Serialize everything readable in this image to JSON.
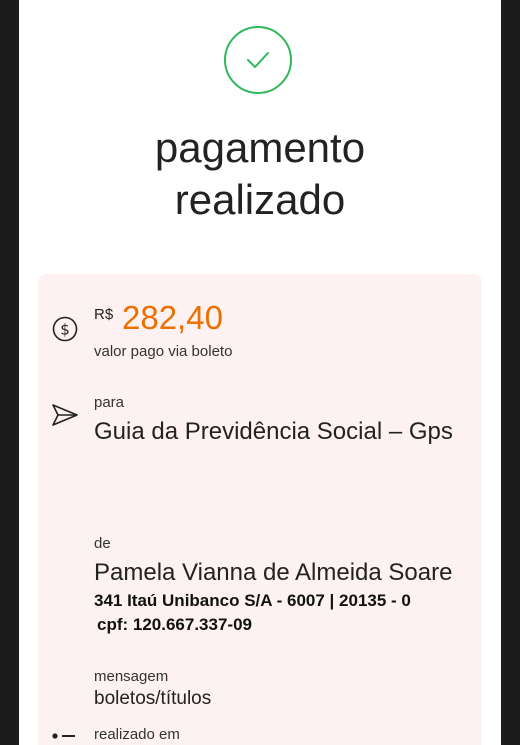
{
  "status": {
    "title_line1": "pagamento",
    "title_line2": "realizado"
  },
  "receipt": {
    "currency": "R$",
    "amount": "282,40",
    "amount_desc": "valor pago via boleto",
    "to_label": "para",
    "to_value": "Guia da Previdência Social – Gps",
    "from_label": "de",
    "from_name": "Pamela Vianna de Almeida Soare",
    "from_bank": "341 Itaú Unibanco S/A - 6007 | 20135 - 0",
    "from_cpf": "cpf: 120.667.337-09",
    "message_label": "mensagem",
    "message_value": "boletos/títulos",
    "date_label": "realizado em"
  },
  "colors": {
    "success": "#2fb85a",
    "amount": "#ec7000",
    "card_bg": "#fdf2f1"
  }
}
